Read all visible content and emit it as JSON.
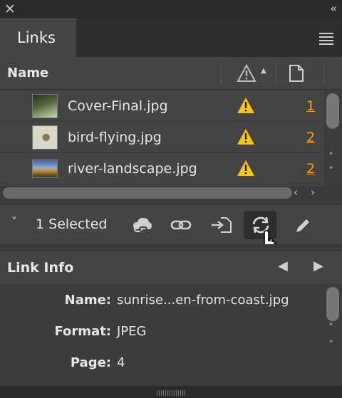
{
  "window": {
    "close_glyph": "✕",
    "collapse_glyph": "‹‹"
  },
  "panel": {
    "tab_label": "Links",
    "menu_icon": "hamburger-menu-icon"
  },
  "columns": {
    "name_header": "Name",
    "status_icon": "warning-icon",
    "sort_glyph": "▲",
    "page_icon": "page-icon"
  },
  "links": [
    {
      "name": "Cover-Final.jpg",
      "page": "1",
      "status": "missing",
      "thumb_colors": [
        "#2f3a22",
        "#9bb38a"
      ]
    },
    {
      "name": "bird-flying.jpg",
      "page": "2",
      "status": "missing",
      "thumb_colors": [
        "#d6d6c8",
        "#8a7a4a"
      ]
    },
    {
      "name": "river-landscape.jpg",
      "page": "2",
      "status": "missing",
      "thumb_colors": [
        "#4a6ea8",
        "#c88a3a"
      ]
    }
  ],
  "scroll": {
    "left_glyph": "‹",
    "right_glyph": "›",
    "up_glyph": "˄",
    "down_glyph": "˅"
  },
  "actions": {
    "chevron_glyph": "˅",
    "selection_label": "1 Selected",
    "buttons": [
      {
        "name": "cc-library-link-icon",
        "active": false
      },
      {
        "name": "relink-icon",
        "active": false
      },
      {
        "name": "go-to-link-icon",
        "active": false
      },
      {
        "name": "update-link-icon",
        "active": true
      },
      {
        "name": "edit-original-icon",
        "active": false
      }
    ]
  },
  "link_info": {
    "title": "Link Info",
    "prev_glyph": "◀",
    "next_glyph": "▶",
    "fields": [
      {
        "label": "Name:",
        "value": "sunrise...en-from-coast.jpg"
      },
      {
        "label": "Format:",
        "value": "JPEG"
      },
      {
        "label": "Page:",
        "value": "4"
      }
    ]
  },
  "colors": {
    "warning": "#f5c518",
    "page_link": "#f0a020",
    "panel_bg": "#444444",
    "active_button_bg": "#2e2e2e"
  }
}
